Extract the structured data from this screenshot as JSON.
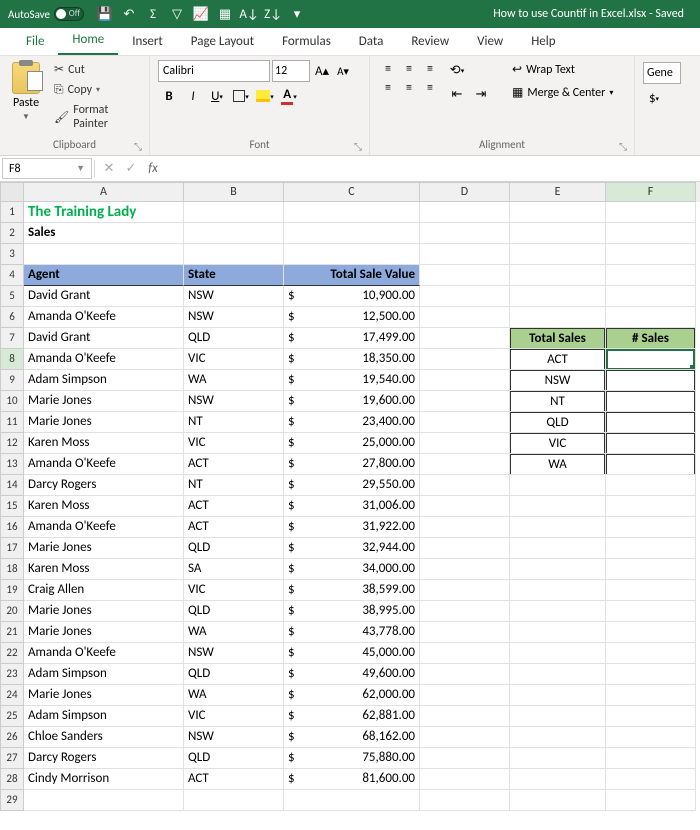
{
  "titlebar": {
    "autosave": "AutoSave",
    "toggle_state": "Off",
    "document": "How to use Countif in Excel.xlsx  -  Saved"
  },
  "tabs": [
    "File",
    "Home",
    "Insert",
    "Page Layout",
    "Formulas",
    "Data",
    "Review",
    "View",
    "Help"
  ],
  "clipboard": {
    "paste": "Paste",
    "cut": "Cut",
    "copy": "Copy",
    "format_painter": "Format Painter",
    "group": "Clipboard"
  },
  "font": {
    "name": "Calibri",
    "size": "12",
    "group": "Font"
  },
  "alignment": {
    "wrap": "Wrap Text",
    "merge": "Merge & Center",
    "group": "Alignment"
  },
  "number": {
    "format": "Gene"
  },
  "name_box": "F8",
  "formula": "",
  "columns": [
    "A",
    "B",
    "C",
    "D",
    "E",
    "F"
  ],
  "sheet": {
    "a1": "The Training Lady",
    "a2": "Sales",
    "headers": {
      "agent": "Agent",
      "state": "State",
      "total": "Total Sale Value"
    },
    "data": [
      {
        "r": 5,
        "agent": "David Grant",
        "state": "NSW",
        "amt": "10,900.00"
      },
      {
        "r": 6,
        "agent": "Amanda O'Keefe",
        "state": "NSW",
        "amt": "12,500.00"
      },
      {
        "r": 7,
        "agent": "David Grant",
        "state": "QLD",
        "amt": "17,499.00"
      },
      {
        "r": 8,
        "agent": "Amanda O'Keefe",
        "state": "VIC",
        "amt": "18,350.00"
      },
      {
        "r": 9,
        "agent": "Adam Simpson",
        "state": "WA",
        "amt": "19,540.00"
      },
      {
        "r": 10,
        "agent": "Marie Jones",
        "state": "NSW",
        "amt": "19,600.00"
      },
      {
        "r": 11,
        "agent": "Marie Jones",
        "state": "NT",
        "amt": "23,400.00"
      },
      {
        "r": 12,
        "agent": "Karen Moss",
        "state": "VIC",
        "amt": "25,000.00"
      },
      {
        "r": 13,
        "agent": "Amanda O'Keefe",
        "state": "ACT",
        "amt": "27,800.00"
      },
      {
        "r": 14,
        "agent": "Darcy Rogers",
        "state": "NT",
        "amt": "29,550.00"
      },
      {
        "r": 15,
        "agent": "Karen Moss",
        "state": "ACT",
        "amt": "31,006.00"
      },
      {
        "r": 16,
        "agent": "Amanda O'Keefe",
        "state": "ACT",
        "amt": "31,922.00"
      },
      {
        "r": 17,
        "agent": "Marie Jones",
        "state": "QLD",
        "amt": "32,944.00"
      },
      {
        "r": 18,
        "agent": "Karen Moss",
        "state": "SA",
        "amt": "34,000.00"
      },
      {
        "r": 19,
        "agent": "Craig Allen",
        "state": "VIC",
        "amt": "38,599.00"
      },
      {
        "r": 20,
        "agent": "Marie Jones",
        "state": "QLD",
        "amt": "38,995.00"
      },
      {
        "r": 21,
        "agent": "Marie Jones",
        "state": "WA",
        "amt": "43,778.00"
      },
      {
        "r": 22,
        "agent": "Amanda O'Keefe",
        "state": "NSW",
        "amt": "45,000.00"
      },
      {
        "r": 23,
        "agent": "Adam Simpson",
        "state": "QLD",
        "amt": "49,600.00"
      },
      {
        "r": 24,
        "agent": "Marie Jones",
        "state": "WA",
        "amt": "62,000.00"
      },
      {
        "r": 25,
        "agent": "Adam Simpson",
        "state": "VIC",
        "amt": "62,881.00"
      },
      {
        "r": 26,
        "agent": "Chloe Sanders",
        "state": "NSW",
        "amt": "68,162.00"
      },
      {
        "r": 27,
        "agent": "Darcy Rogers",
        "state": "QLD",
        "amt": "75,880.00"
      },
      {
        "r": 28,
        "agent": "Cindy Morrison",
        "state": "ACT",
        "amt": "81,600.00"
      }
    ],
    "side": {
      "head_e": "Total Sales",
      "head_f": "# Sales",
      "states": [
        "ACT",
        "NSW",
        "NT",
        "QLD",
        "VIC",
        "WA"
      ]
    }
  }
}
